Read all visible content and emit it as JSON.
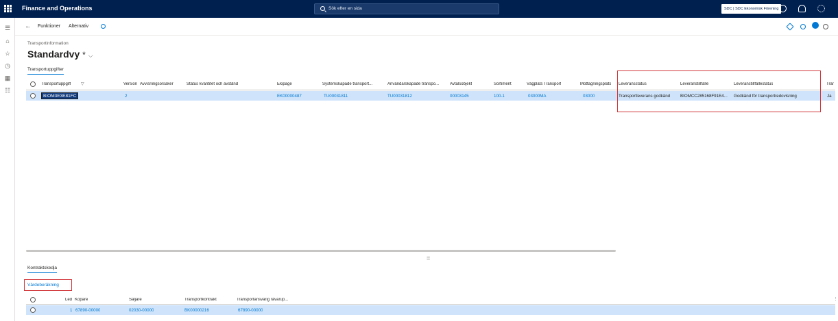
{
  "topbar": {
    "app_title": "Finance and Operations",
    "search_placeholder": "Sök efter en sida",
    "company": "SDC | SDC Ekonomisk Förening"
  },
  "actionbar": {
    "functions": "Funktioner",
    "options": "Alternativ"
  },
  "page": {
    "breadcrumb": "Transportinformation",
    "view_name": "Standardvy",
    "view_modified": "*"
  },
  "tabs": {
    "main": "Transportuppgifter",
    "contract_chain": "Kontraktskedja",
    "value_increase": "Värdeberäkning"
  },
  "grid": {
    "columns": [
      "Transportuppgift",
      "Version",
      "Avvisningsorsaker",
      "Status kvantitet och avstånd",
      "Ekipage",
      "Systemskapade transport...",
      "Användarskapade transpo...",
      "Avtalsobjekt",
      "Sortiment",
      "Vägplats Transport",
      "Mottagningsplats",
      "Leveransstatus",
      "Leveranstillfälle",
      "Leveranstillfällestatus",
      "Trar"
    ],
    "row": {
      "id": "BIOM3E3E81FC",
      "version": "2",
      "ekipage": "EK00000487",
      "system_transport": "TU00031811",
      "user_transport": "TU00031812",
      "avtalsobjekt": "00003145",
      "sortiment": "100-1",
      "vagplats": "03000MA",
      "mottagningsplats": "03000",
      "leveransstatus": "Transportleverans godkänd",
      "leveranstillfalle": "BIOMCC285168F91E4...",
      "leveranstillfallestatus": "Godkänd för transportredovisning",
      "trar": "Ja"
    }
  },
  "subgrid": {
    "columns": [
      "Led",
      "Köpare",
      "Säljare",
      "Transportkontrakt",
      "Transportansvarig råvaruägare"
    ],
    "column_labels_shown": [
      "Led",
      "Köpare",
      "Säljare",
      "Transportkontrakt",
      "Transportansvarig råvarup..."
    ],
    "row": {
      "led": "1",
      "kopare": "67890-00000",
      "saljare": "02030-00000",
      "kontrakt": "BK00000216",
      "ansvarig": "67890-00000"
    }
  },
  "colors": {
    "topbar": "#002050",
    "accent": "#0078d4",
    "selection": "#cfe4fa",
    "highlight_box": "#d13438"
  }
}
